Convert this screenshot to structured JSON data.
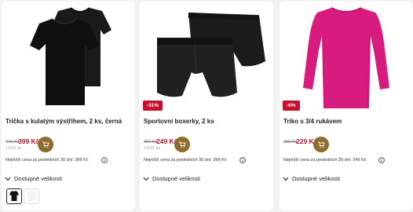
{
  "currency": "Kč",
  "products": [
    {
      "title": "Trička s kulatým výstřihem, 2 ks, černá",
      "old_price": "449 Kč",
      "price": "399 Kč",
      "unit_price": "1 Kč/1 ks",
      "discount": "",
      "lowest_price_note": "Nejnižší cena za posledních 30 dní: 399 Kč",
      "sizes_label": "Dostupné velikosti",
      "image": "black-tshirts-2pack"
    },
    {
      "title": "Sportovní boxerky, 2 ks",
      "old_price": "359 Kč",
      "price": "249 Kč",
      "unit_price": "1 Kč/1 ks",
      "discount": "-31%",
      "lowest_price_note": "Nejnižší cena za posledních 30 dní: 399 Kč",
      "sizes_label": "Dostupné velikosti",
      "image": "black-boxers-2pack"
    },
    {
      "title": "Triko s 3/4 rukávem",
      "old_price": "299 Kč",
      "price": "229 Kč",
      "unit_price": "",
      "discount": "-6%",
      "lowest_price_note": "Nejnižší cena za posledních 30 dní: 249 Kč",
      "sizes_label": "Dostupné velikosti",
      "image": "pink-longsleeve-top"
    }
  ],
  "colors": {
    "price_red": "#c8102e",
    "cart_button": "#8c6d2e",
    "badge_red": "#c8102e",
    "pink_top": "#d81b7e"
  },
  "icons": [
    "cart-icon",
    "info-icon",
    "chevron-down-icon"
  ]
}
